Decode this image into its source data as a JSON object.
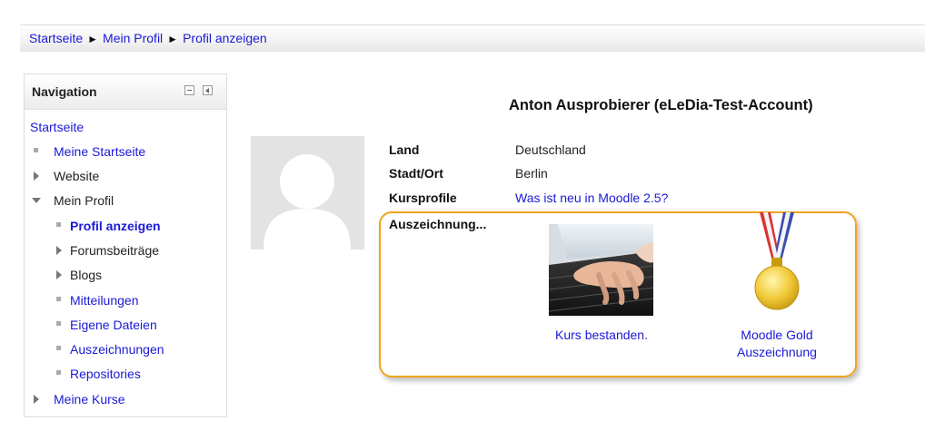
{
  "breadcrumb": {
    "items": [
      "Startseite",
      "Mein Profil",
      "Profil anzeigen"
    ],
    "separator": "►"
  },
  "navigation": {
    "title": "Navigation",
    "controls": [
      "minimize-icon",
      "dock-icon"
    ],
    "root": "Startseite",
    "items": [
      {
        "label": "Meine Startseite",
        "type": "link"
      },
      {
        "label": "Website",
        "type": "collapsed"
      },
      {
        "label": "Mein Profil",
        "type": "expanded"
      },
      {
        "label": "Profil anzeigen",
        "type": "current"
      },
      {
        "label": "Forumsbeiträge",
        "type": "collapsed"
      },
      {
        "label": "Blogs",
        "type": "collapsed"
      },
      {
        "label": "Mitteilungen",
        "type": "link"
      },
      {
        "label": "Eigene Dateien",
        "type": "link"
      },
      {
        "label": "Auszeichnungen",
        "type": "link"
      },
      {
        "label": "Repositories",
        "type": "link"
      },
      {
        "label": "Meine Kurse",
        "type": "collapsed-link"
      }
    ]
  },
  "profile": {
    "name": "Anton Ausprobierer (eLeDia-Test-Account)",
    "fields": [
      {
        "label": "Land",
        "value": "Deutschland"
      },
      {
        "label": "Stadt/Ort",
        "value": "Berlin"
      },
      {
        "label": "Kursprofile",
        "value": "Was ist neu in Moodle 2.5?"
      }
    ],
    "badges_label": "Auszeichnung...",
    "badges": [
      {
        "label_line1": "Kurs bestanden.",
        "label_line2": "",
        "icon": "laptop-typing-image"
      },
      {
        "label_line1": "Moodle Gold",
        "label_line2": "Auszeichnung",
        "icon": "gold-medal-image"
      }
    ]
  },
  "colors": {
    "link": "#1a1ad6",
    "highlight_border": "#f0a51e",
    "avatar_bg": "#e5e5e5"
  }
}
